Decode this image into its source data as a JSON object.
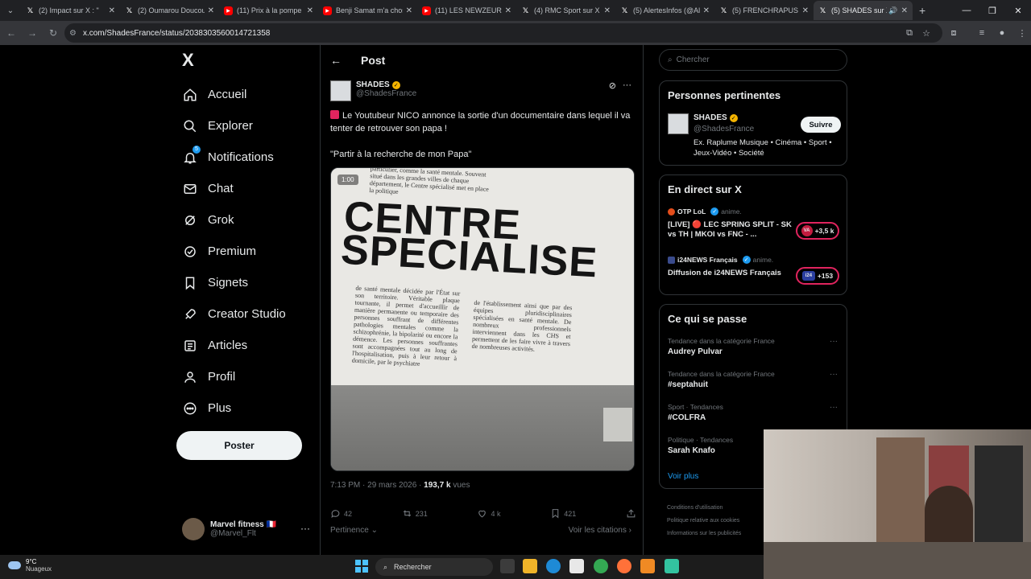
{
  "browser": {
    "tabs": [
      {
        "title": "(2) Impact sur X : \"",
        "icon": "x"
      },
      {
        "title": "(2) Oumarou Doucou",
        "icon": "x"
      },
      {
        "title": "(11) Prix à la pompe",
        "icon": "youtube"
      },
      {
        "title": "Benji Samat m'a chos",
        "icon": "youtube"
      },
      {
        "title": "(11) LES NEWZEURS",
        "icon": "youtube"
      },
      {
        "title": "(4) RMC Sport sur X",
        "icon": "x"
      },
      {
        "title": "(5) AlertesInfos (@Al",
        "icon": "x"
      },
      {
        "title": "(5) FRENCHRAPUS u",
        "icon": "x"
      },
      {
        "title": "(5) SHADES sur X",
        "icon": "x",
        "active": true
      }
    ],
    "url": "x.com/ShadesFrance/status/2038303560014721358"
  },
  "nav": {
    "logo": "X",
    "items": [
      {
        "label": "Accueil",
        "icon": "home-icon"
      },
      {
        "label": "Explorer",
        "icon": "search-icon"
      },
      {
        "label": "Notifications",
        "icon": "bell-icon",
        "badge": "5"
      },
      {
        "label": "Chat",
        "icon": "mail-icon"
      },
      {
        "label": "Grok",
        "icon": "grok-icon"
      },
      {
        "label": "Premium",
        "icon": "premium-icon"
      },
      {
        "label": "Signets",
        "icon": "bookmark-icon"
      },
      {
        "label": "Creator Studio",
        "icon": "rocket-icon"
      },
      {
        "label": "Articles",
        "icon": "article-icon"
      },
      {
        "label": "Profil",
        "icon": "person-icon"
      },
      {
        "label": "Plus",
        "icon": "more-icon"
      }
    ],
    "post_button": "Poster",
    "account": {
      "name": "Marvel fitness 🇫🇷",
      "handle": "@Marvel_Flt"
    }
  },
  "main": {
    "title": "Post",
    "author": {
      "name": "SHADES",
      "handle": "@ShadesFrance"
    },
    "text_line1": "Le Youtubeur NICO annonce la sortie d'un documentaire dans lequel il va tenter de retrouver son papa !",
    "text_line2": "\"Partir à la recherche de mon Papa\"",
    "media": {
      "duration": "1:00",
      "headline1": "CENTRE",
      "headline2": "SPECIALISE",
      "snippet_top": "particulier, comme la santé mentale. Souvent situé dans les grandes villes de chaque département, le Centre spécialisé met en place la politique",
      "snippet_left": "de santé mentale décidée par l'État sur son territoire. Véritable plaque tournante, il permet d'accueillir de manière permanente ou temporaire des personnes souffrant de différentes pathologies mentales comme la schizophrénie, la bipolarité ou encore la démence. Les personnes souffrantes sont accompagnées tout au long de l'hospitalisation, puis à leur retour à domicile, par le psychiatre",
      "snippet_right": "de l'établissement ainsi que par des équipes pluridisciplinaires spécialisées en santé mentale. De nombreux professionnels interviennent dans les CHS et permettent de les faire vivre à travers de nombreuses activités."
    },
    "meta_time": "7:13 PM · 29 mars 2026 · ",
    "meta_views": "193,7 k",
    "meta_views_label": " vues",
    "stats": {
      "replies": "42",
      "reposts": "231",
      "likes": "4 k",
      "bookmarks": "421"
    },
    "pertinence": "Pertinence",
    "citations": "Voir les citations"
  },
  "right": {
    "search_placeholder": "Chercher",
    "people_title": "Personnes pertinentes",
    "person": {
      "name": "SHADES",
      "handle": "@ShadesFrance",
      "bio": "Ex. Raplume Musique • Cinéma • Sport • Jeux-Vidéo • Société",
      "follow": "Suivre"
    },
    "live_title": "En direct sur X",
    "lives": [
      {
        "channel": "OTP LoL",
        "anime": "anime.",
        "text": "[LIVE] 🔴 LEC SPRING SPLIT - SK vs TH | MKOI vs FNC - ...",
        "count": "+3,5 k"
      },
      {
        "channel": "i24NEWS Français",
        "anime": "anime.",
        "text": "Diffusion de i24NEWS Français",
        "count": "+153"
      }
    ],
    "happening_title": "Ce qui se passe",
    "trends": [
      {
        "category": "Tendance dans la catégorie France",
        "title": "Audrey Pulvar"
      },
      {
        "category": "Tendance dans la catégorie France",
        "title": "#septahuit"
      },
      {
        "category": "Sport · Tendances",
        "title": "#COLFRA"
      },
      {
        "category": "Politique · Tendances",
        "title": "Sarah Knafo"
      }
    ],
    "see_more": "Voir plus",
    "footer": [
      "Conditions d'utilisation",
      "Politique relative aux cookies",
      "Informations sur les publicités"
    ]
  },
  "taskbar": {
    "temperature": "9°C",
    "weather": "Nuageux",
    "search": "Rechercher"
  }
}
